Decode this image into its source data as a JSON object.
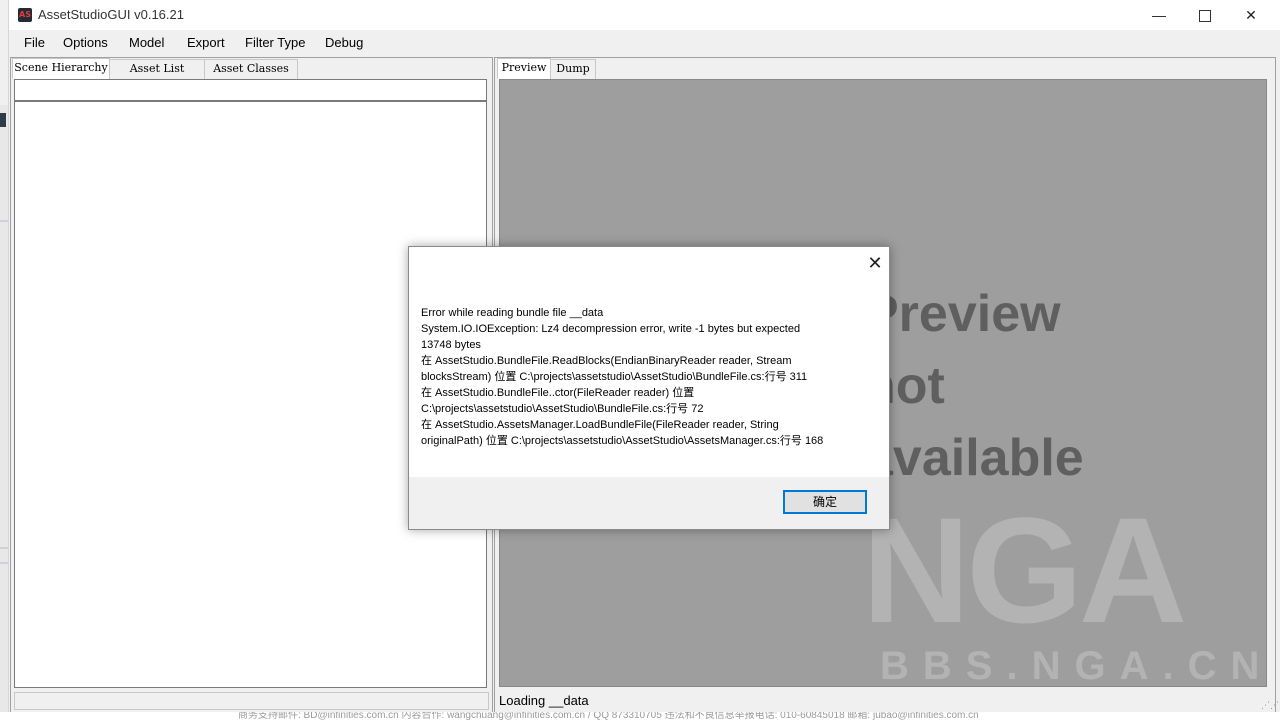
{
  "window": {
    "title": "AssetStudioGUI v0.16.21",
    "icon_label": "AS",
    "minimize_glyph": "—",
    "close_glyph": "✕"
  },
  "menu": [
    "File",
    "Options",
    "Model",
    "Export",
    "Filter Type",
    "Debug"
  ],
  "left_tabs": [
    "Scene Hierarchy",
    "Asset List",
    "Asset Classes"
  ],
  "right_tabs": [
    "Preview",
    "Dump"
  ],
  "preview_placeholder": [
    "Preview",
    "not",
    "available"
  ],
  "watermark": {
    "logo": "NGA",
    "site": "BBS.NGA.CN"
  },
  "status": "Loading __data",
  "dialog": {
    "close_glyph": "✕",
    "message_lines": [
      "Error while reading bundle file __data",
      "System.IO.IOException: Lz4 decompression error, write -1 bytes but expected",
      "13748 bytes",
      "   在 AssetStudio.BundleFile.ReadBlocks(EndianBinaryReader reader, Stream",
      "blocksStream) 位置 C:\\projects\\assetstudio\\AssetStudio\\BundleFile.cs:行号 311",
      "   在 AssetStudio.BundleFile..ctor(FileReader reader) 位置",
      "C:\\projects\\assetstudio\\AssetStudio\\BundleFile.cs:行号 72",
      "   在 AssetStudio.AssetsManager.LoadBundleFile(FileReader reader, String",
      "originalPath) 位置 C:\\projects\\assetstudio\\AssetStudio\\AssetsManager.cs:行号 168"
    ],
    "ok_label": "确定"
  },
  "footer_text": "商务支持邮件: BD@infinities.com.cn    内容合作: wangchuang@infinities.com.cn / QQ 873310705    违法和不良信息举报电话: 010-60845018 邮箱: jubao@infinities.com.cn"
}
